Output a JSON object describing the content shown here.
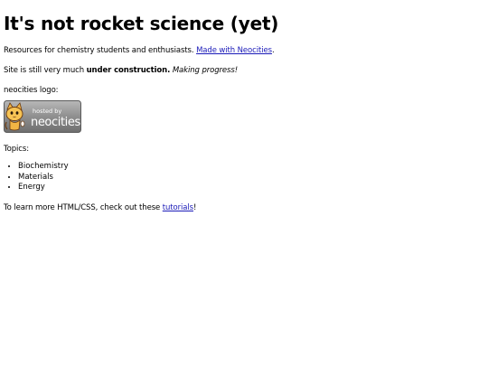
{
  "header": {
    "title": "It's not rocket science (yet)"
  },
  "intro": {
    "text": "Resources for chemistry students and enthusiasts. ",
    "link_label": "Made with Neocities",
    "end": "."
  },
  "status": {
    "lead": "Site is still very much ",
    "bold": "under construction.",
    "italic": "Making progress!"
  },
  "logo": {
    "caption": "neocities logo:",
    "badge_small": "hosted by",
    "badge_big": "neocities"
  },
  "topics": {
    "label": "Topics:",
    "items": [
      "Biochemistry",
      "Materials",
      "Energy"
    ]
  },
  "tutorials": {
    "lead": "To learn more HTML/CSS, check out these ",
    "link_label": "tutorials",
    "end": "!"
  }
}
